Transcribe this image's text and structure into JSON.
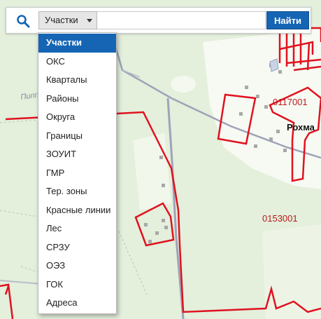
{
  "search": {
    "layer_selected": "Участки",
    "input_value": "",
    "input_placeholder": "",
    "button_label": "Найти"
  },
  "dropdown": {
    "items": [
      {
        "label": "Участки",
        "selected": true
      },
      {
        "label": "ОКС"
      },
      {
        "label": "Кварталы"
      },
      {
        "label": "Районы"
      },
      {
        "label": "Округа"
      },
      {
        "label": "Границы"
      },
      {
        "label": "ЗОУИТ"
      },
      {
        "label": "ГМР"
      },
      {
        "label": "Тер. зоны"
      },
      {
        "label": "Красные линии"
      },
      {
        "label": "Лес"
      },
      {
        "label": "СРЗУ"
      },
      {
        "label": "ОЭЗ"
      },
      {
        "label": "ГОК"
      },
      {
        "label": "Адреса"
      }
    ]
  },
  "map": {
    "labels": {
      "village": "Рохма",
      "quarter_1": "0117001",
      "quarter_2": "0153001",
      "road": "Пипп"
    },
    "colors": {
      "forest": "#e4efdc",
      "clearing": "#f7faf3",
      "road": "#9ea3b8",
      "parcel": "#e0121f",
      "quarter_label": "#b71c1c",
      "accent": "#1565b4"
    }
  }
}
